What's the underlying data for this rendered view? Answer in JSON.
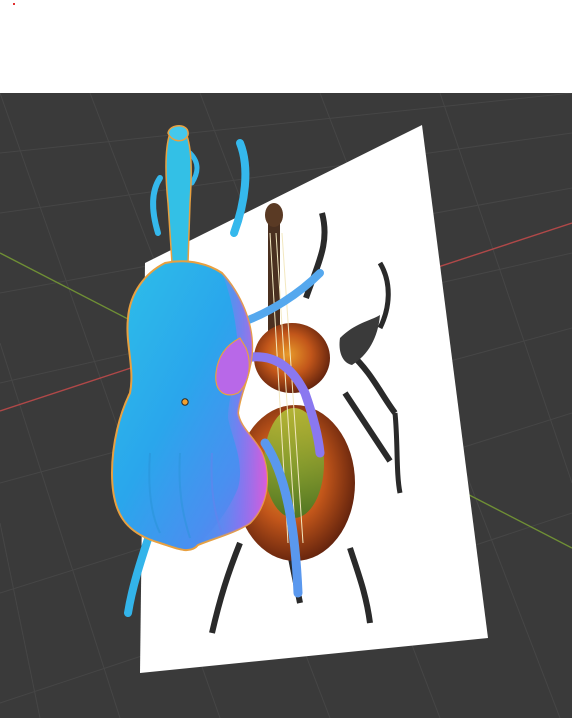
{
  "viewport": {
    "background": "#3a3a3a",
    "grid_color": "#4a4a4a",
    "x_axis_color": "#b04848",
    "y_axis_color": "#6f8f35"
  },
  "scene": {
    "reference_image_plane": {
      "color": "#ffffff",
      "subject": "violin-beetle-illustration"
    },
    "normal_map_mesh": {
      "colors": [
        "#1fb4e6",
        "#3fa0f0",
        "#7a7cf0",
        "#c060e8",
        "#e858d8"
      ],
      "outline_color": "#e8a040"
    },
    "origin_marker_color": "#f0a030"
  }
}
